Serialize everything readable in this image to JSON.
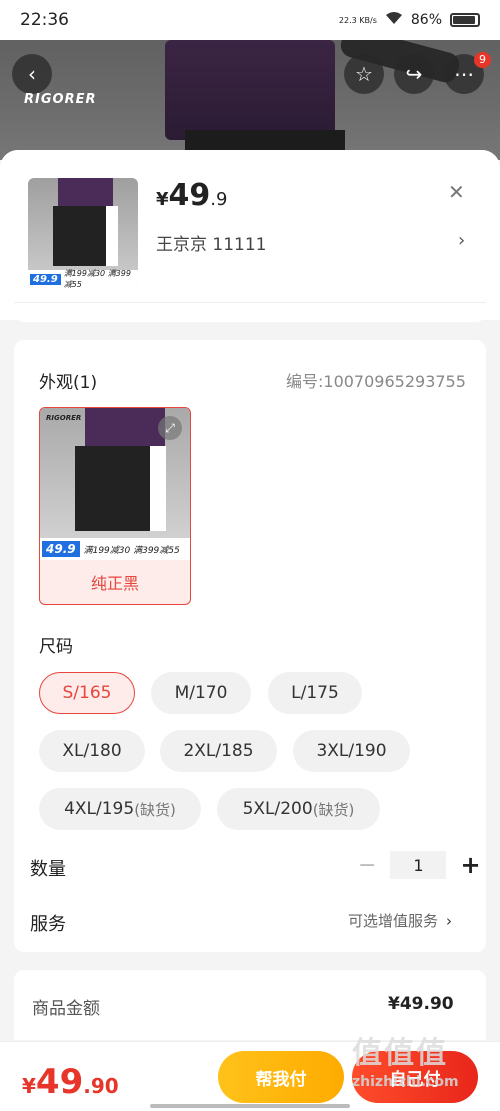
{
  "status_bar": {
    "time": "22:36",
    "net_speed": "22.3 KB/s",
    "battery": "86%"
  },
  "header": {
    "brand": "RIGORER",
    "badge_count": "9"
  },
  "sku": {
    "price_symbol": "¥",
    "price_int": "49",
    "price_dec": ".9",
    "address": "王京京  11111",
    "thumb_price": "49.9",
    "thumb_promo": "满199减30 满399减55"
  },
  "appearance": {
    "title": "外观(1)",
    "code": "编号:10070965293755",
    "options": [
      {
        "label": "纯正黑",
        "promo_price": "49.9",
        "promo_text": "满199减30 满399减55",
        "logo": "RIGORER"
      }
    ]
  },
  "size": {
    "title": "尺码",
    "options": [
      {
        "label": "S/165",
        "selected": true,
        "oos": ""
      },
      {
        "label": "M/170",
        "selected": false,
        "oos": ""
      },
      {
        "label": "L/175",
        "selected": false,
        "oos": ""
      },
      {
        "label": "XL/180",
        "selected": false,
        "oos": ""
      },
      {
        "label": "2XL/185",
        "selected": false,
        "oos": ""
      },
      {
        "label": "3XL/190",
        "selected": false,
        "oos": ""
      },
      {
        "label": "4XL/195",
        "selected": false,
        "oos": "(缺货)"
      },
      {
        "label": "5XL/200",
        "selected": false,
        "oos": "(缺货)"
      }
    ]
  },
  "quantity": {
    "label": "数量",
    "value": "1",
    "minus": "−",
    "plus": "+"
  },
  "service": {
    "label": "服务",
    "value": "可选增值服务"
  },
  "summary": {
    "label": "商品金额",
    "value": "¥49.90"
  },
  "bottom_bar": {
    "price_symbol": "¥",
    "price_int": "49",
    "price_dec": ".90",
    "help_pay": "帮我付",
    "self_pay": "自己付"
  },
  "watermark": {
    "big": "值值值",
    "small": "zhizhizhi.com"
  },
  "colors": {
    "accent_red": "#e8352a",
    "yellow": "#ffb000"
  }
}
